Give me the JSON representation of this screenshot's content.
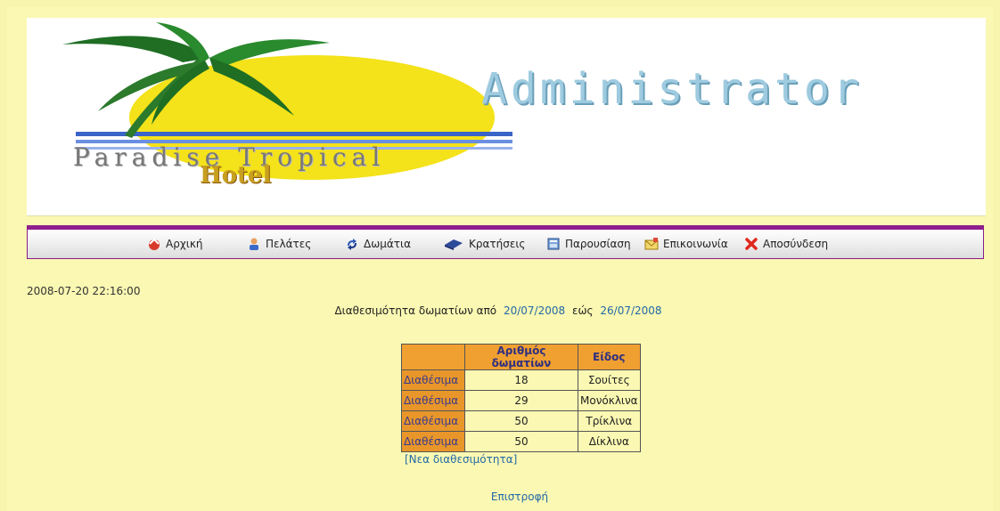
{
  "banner": {
    "hotel_name": "Paradise Tropical",
    "hotel_sub": "Hotel",
    "role_title": "Administrator"
  },
  "nav": {
    "items": [
      {
        "label": "Αρχική",
        "icon": "home-icon"
      },
      {
        "label": "Πελάτες",
        "icon": "user-icon"
      },
      {
        "label": "Δωμάτια",
        "icon": "rooms-icon"
      },
      {
        "label": "Κρατήσεις",
        "icon": "book-icon"
      },
      {
        "label": "Παρουσίαση",
        "icon": "presentation-icon"
      },
      {
        "label": "Επικοινωνία",
        "icon": "mail-icon"
      },
      {
        "label": "Αποσύνδεση",
        "icon": "logout-icon"
      }
    ]
  },
  "status": {
    "timestamp": "2008-07-20 22:16:00"
  },
  "availability": {
    "prefix": "Διαθεσιμότητα δωματίων από",
    "from_date": "20/07/2008",
    "middle": "εώς",
    "to_date": "26/07/2008"
  },
  "table": {
    "headers": [
      "",
      "Αριθμός δωματίων",
      "Είδος"
    ],
    "rows": [
      {
        "label": "Διαθέσιμα",
        "count": "18",
        "type": "Σουίτες"
      },
      {
        "label": "Διαθέσιμα",
        "count": "29",
        "type": "Μονόκλινα"
      },
      {
        "label": "Διαθέσιμα",
        "count": "50",
        "type": "Τρίκλινα"
      },
      {
        "label": "Διαθέσιμα",
        "count": "50",
        "type": "Δίκλινα"
      }
    ]
  },
  "links": {
    "new_availability": "[Νεα διαθεσιμότητα]",
    "back": "Επιστροφή"
  },
  "colors": {
    "page_bg": "#f8f6ae",
    "nav_border": "#8e1f8e",
    "table_header": "#f0a030",
    "link": "#2469a8"
  }
}
